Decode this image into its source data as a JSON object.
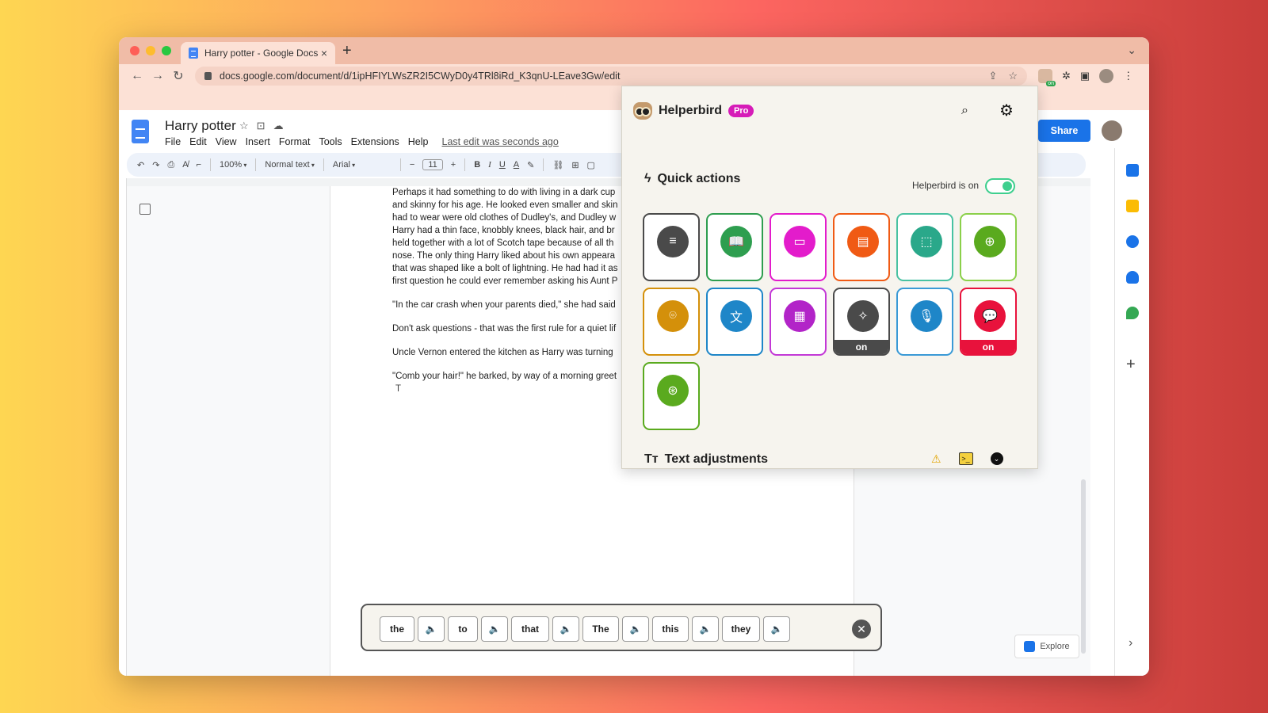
{
  "browser": {
    "tab_title": "Harry potter - Google Docs",
    "tab_close": "×",
    "new_tab": "+",
    "tab_menu": "⌄",
    "url": "docs.google.com/document/d/1ipHFIYLWsZR2I5CWyD0y4TRl8iRd_K3qnU-LEave3Gw/edit",
    "back": "←",
    "forward": "→",
    "reload": "↻",
    "share_icon": "⇪",
    "bookmark_icon": "☆",
    "puzzle_icon": "✲",
    "sidebar_icon": "▣",
    "kebab": "⋮",
    "traffic_colors": [
      "#fe5f57",
      "#febc2e",
      "#28c840"
    ]
  },
  "docs": {
    "title": "Harry potter",
    "star_icon": "☆",
    "move_icon": "⊡",
    "cloud_icon": "☁",
    "menu": [
      "File",
      "Edit",
      "View",
      "Insert",
      "Format",
      "Tools",
      "Extensions",
      "Help"
    ],
    "last_edit": "Last edit was seconds ago",
    "share": "Share",
    "toolbar": {
      "undo": "↶",
      "redo": "↷",
      "print": "⎙",
      "spell": "A̸",
      "paint": "⌐",
      "zoom": "100%",
      "style": "Normal text",
      "font": "Arial",
      "minus": "−",
      "size": "11",
      "plus": "+",
      "bold": "B",
      "italic": "I",
      "underline": "U",
      "color": "A",
      "highlight": "✎",
      "link": "⛓",
      "comment": "⊞",
      "image": "▢"
    },
    "body_lines": [
      "Perhaps it had something to do with living in a dark cup",
      "and skinny for his age. He looked even smaller and skin",
      "had to wear were old clothes of Dudley's, and Dudley w",
      "Harry had a thin face, knobbly knees, black hair, and br",
      "held together with a lot of Scotch tape because of all th",
      "nose. The only thing Harry liked about his own appeara",
      "that was shaped like a bolt of lightning. He had had it as",
      "first question he could ever remember asking his Aunt P"
    ],
    "paragraphs": [
      "\"In the car crash when your parents died,\" she had said",
      "Don't ask questions - that was the first rule for a quiet lif",
      "Uncle Vernon entered the kitchen as Harry was turning",
      "\"Comb your hair!\" he barked, by way of a morning greet"
    ],
    "cursor_line": "T",
    "explore": "Explore",
    "side_add": "+",
    "side_chevron": "›"
  },
  "helperbird": {
    "name": "Helperbird",
    "badge": "Pro",
    "search_icon": "⌕",
    "gear_icon": "⚙",
    "quick_actions_title": "Quick actions",
    "bolt_icon": "ϟ",
    "status_label": "Helperbird is on",
    "toggle_on": true,
    "tiles": [
      {
        "icon": "≡",
        "color": "#4a4a4a",
        "border": "#4a4a4a"
      },
      {
        "icon": "📖",
        "color": "#2e9e4f",
        "border": "#2e9e4f"
      },
      {
        "icon": "▭",
        "color": "#e31ccb",
        "border": "#e31ccb"
      },
      {
        "icon": "▤",
        "color": "#f05a14",
        "border": "#f05a14"
      },
      {
        "icon": "⬚",
        "color": "#2aa88a",
        "border": "#48c2a2"
      },
      {
        "icon": "⊕",
        "color": "#5aaa1e",
        "border": "#8bd04a"
      },
      {
        "icon": "⌾",
        "color": "#d4900a",
        "border": "#d4900a"
      },
      {
        "icon": "文",
        "color": "#1e86c8",
        "border": "#1e86c8"
      },
      {
        "icon": "▦",
        "color": "#b224c8",
        "border": "#c338d6"
      },
      {
        "icon": "✧",
        "color": "#4a4a4a",
        "border": "#4a4a4a",
        "on": "on"
      },
      {
        "icon": "🎙",
        "color": "#1e86c8",
        "border": "#3a9ad6"
      },
      {
        "icon": "💬",
        "color": "#e8123c",
        "border": "#e8123c",
        "on": "on"
      },
      {
        "icon": "⊛",
        "color": "#5aaa1e",
        "border": "#5aaa1e"
      }
    ],
    "text_adjustments_title": "Text adjustments",
    "text_adjustments_icon": "Tт",
    "warn_icon": "⚠",
    "term_icon": ">_",
    "chevron_icon": "⌄"
  },
  "word_prediction": {
    "words": [
      "the",
      "to",
      "that",
      "The",
      "this",
      "they"
    ],
    "speaker_icon": "🔈",
    "close_icon": "✕"
  }
}
